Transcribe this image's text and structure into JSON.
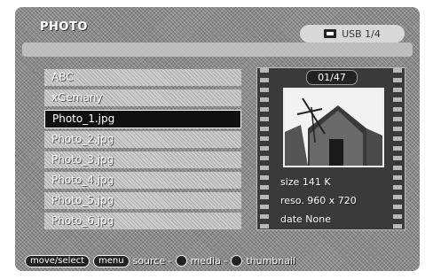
{
  "app": {
    "title": "PHOTO"
  },
  "source": {
    "label": "USB 1/4",
    "icon": "usb-drive-icon"
  },
  "files": [
    {
      "name": "ABC"
    },
    {
      "name": "xGemany"
    },
    {
      "name": "Photo_1.jpg",
      "selected": true
    },
    {
      "name": "Photo_2.jpg"
    },
    {
      "name": "Photo_3.jpg"
    },
    {
      "name": "Photo_4.jpg"
    },
    {
      "name": "Photo_5.jpg"
    },
    {
      "name": "Photo_6.jpg"
    }
  ],
  "preview": {
    "counter": "01/47",
    "size": "size 141 K",
    "resolution": "reso. 960 x 720",
    "date": "date None"
  },
  "help": {
    "keys_pill": "move/select",
    "menu_pill": "menu",
    "source_text": "source -",
    "media_text": "media -",
    "thumbnail_text": "thumbnail"
  }
}
